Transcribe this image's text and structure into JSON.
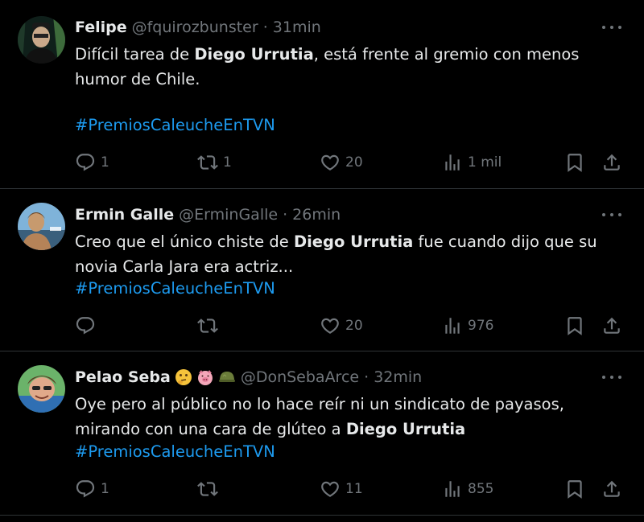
{
  "tweets": [
    {
      "author": "Felipe",
      "meta": "@fquirozbunster · 31min",
      "text_1": "Difícil tarea de ",
      "bold_1": "Diego Urrutia",
      "text_2": ", está frente al gremio con menos humor de Chile.",
      "text_3": "",
      "hashtag": "#PremiosCaleucheEnTVN",
      "replies": "1",
      "retweets": "1",
      "likes": "20",
      "views": "1 mil"
    },
    {
      "author": "Ermin Galle",
      "meta": "@ErminGalle · 26min",
      "text_1": "Creo que el único chiste de ",
      "bold_1": "Diego Urrutia",
      "text_2": " fue cuando dijo que su novia Carla Jara era actriz...",
      "text_3": "",
      "hashtag": "#PremiosCaleucheEnTVN",
      "replies": "",
      "retweets": "",
      "likes": "20",
      "views": "976"
    },
    {
      "author": "Pelao Seba",
      "meta": "@DonSebaArce · 32min",
      "text_1": "Oye pero al público no lo hace reír ni un sindicato de payasos, mirando con una cara de glúteo a ",
      "bold_1": "Diego Urrutia",
      "text_2": "",
      "text_3": "",
      "hashtag": "#PremiosCaleucheEnTVN",
      "replies": "1",
      "retweets": "",
      "likes": "11",
      "views": "855"
    }
  ],
  "icons": {
    "reply": "reply-icon",
    "retweet": "retweet-icon",
    "like": "heart-icon",
    "views": "views-icon",
    "bookmark": "bookmark-icon",
    "share": "share-icon",
    "more": "more-icon"
  },
  "colors": {
    "background": "#000000",
    "text": "#e7e9ea",
    "muted": "#71767b",
    "link": "#1d9bf0",
    "divider": "#2f3336"
  }
}
